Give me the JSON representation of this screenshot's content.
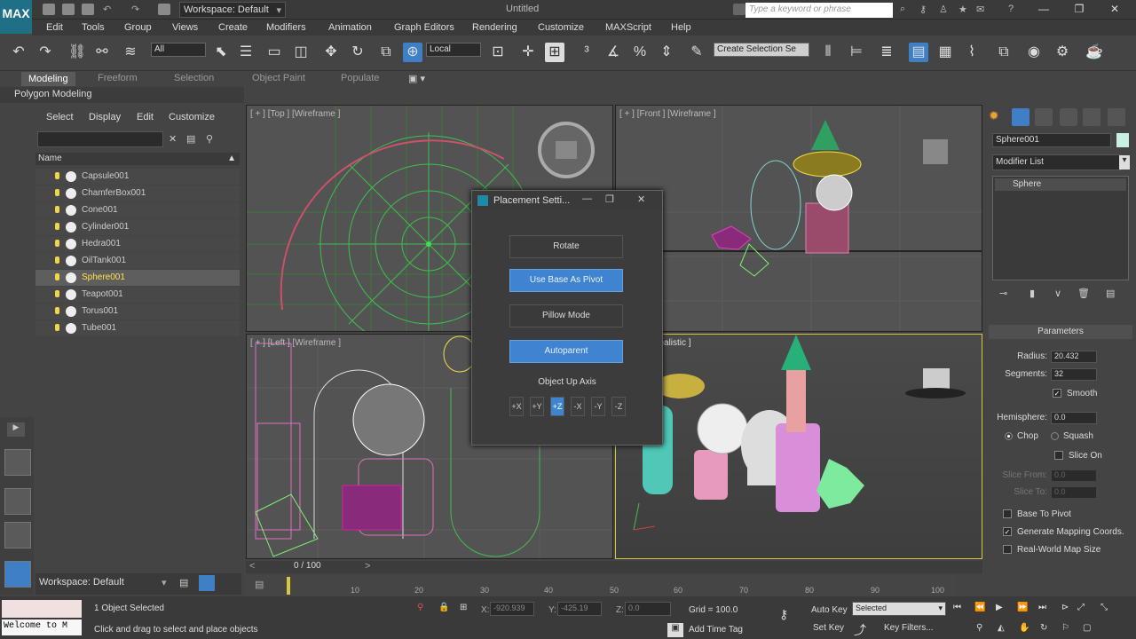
{
  "titlebar": {
    "logo": "MAX",
    "workspace": "Workspace: Default",
    "title": "Untitled",
    "search_placeholder": "Type a keyword or phrase"
  },
  "menu": [
    "Edit",
    "Tools",
    "Group",
    "Views",
    "Create",
    "Modifiers",
    "Animation",
    "Graph Editors",
    "Rendering",
    "Customize",
    "MAXScript",
    "Help"
  ],
  "toolbar": {
    "filter_dd": "All",
    "coord_dd": "Local",
    "selection_set_dd": "Create Selection Se"
  },
  "ribbon": {
    "tabs": [
      "Modeling",
      "Freeform",
      "Selection",
      "Object Paint",
      "Populate"
    ],
    "active": "Modeling",
    "sub": "Polygon Modeling"
  },
  "explorer": {
    "tabs": [
      "Select",
      "Display",
      "Edit",
      "Customize"
    ],
    "column": "Name",
    "objects": [
      "Capsule001",
      "ChamferBox001",
      "Cone001",
      "Cylinder001",
      "Hedra001",
      "OilTank001",
      "Sphere001",
      "Teapot001",
      "Torus001",
      "Tube001"
    ],
    "selected": "Sphere001",
    "workspace": "Workspace: Default"
  },
  "viewports": {
    "top": "[ + ] [Top ] [Wireframe ]",
    "front": "[ + ] [Front ] [Wireframe ]",
    "left": "[ + ] [Left ] [Wireframe ]",
    "persp": "ective ] [Realistic ]"
  },
  "dialog": {
    "title": "Placement Setti...",
    "buttons": [
      "Rotate",
      "Use Base As Pivot",
      "Pillow Mode",
      "Autoparent"
    ],
    "axis_label": "Object Up Axis",
    "axes": [
      "+X",
      "+Y",
      "+Z",
      "-X",
      "-Y",
      "-Z"
    ],
    "active_axis": "+Z"
  },
  "command_panel": {
    "object_name": "Sphere001",
    "modifier_list": "Modifier List",
    "stack_entry": "Sphere",
    "params_title": "Parameters",
    "radius_label": "Radius:",
    "radius": "20.432",
    "segments_label": "Segments:",
    "segments": "32",
    "smooth": "Smooth",
    "hemisphere_label": "Hemisphere:",
    "hemisphere": "0.0",
    "chop": "Chop",
    "squash": "Squash",
    "slice_on": "Slice On",
    "slice_from_label": "Slice From:",
    "slice_from": "0.0",
    "slice_to_label": "Slice To:",
    "slice_to": "0.0",
    "base_to_pivot": "Base To Pivot",
    "gen_mapping": "Generate Mapping Coords.",
    "real_world": "Real-World Map Size"
  },
  "timeline": {
    "frame": "0 / 100",
    "ticks": [
      "10",
      "20",
      "30",
      "40",
      "50",
      "60",
      "70",
      "80",
      "90",
      "100"
    ]
  },
  "status": {
    "maxscript": "Welcome to M",
    "selected": "1 Object Selected",
    "prompt": "Click and drag to select and place objects",
    "x_label": "X:",
    "x": "-920.939",
    "y_label": "Y:",
    "y": "-425.19",
    "z_label": "Z:",
    "z": "0.0",
    "grid": "Grid = 100.0",
    "add_time_tag": "Add Time Tag",
    "auto_key": "Auto Key",
    "set_key": "Set Key",
    "key_dd": "Selected",
    "key_filters": "Key Filters..."
  }
}
